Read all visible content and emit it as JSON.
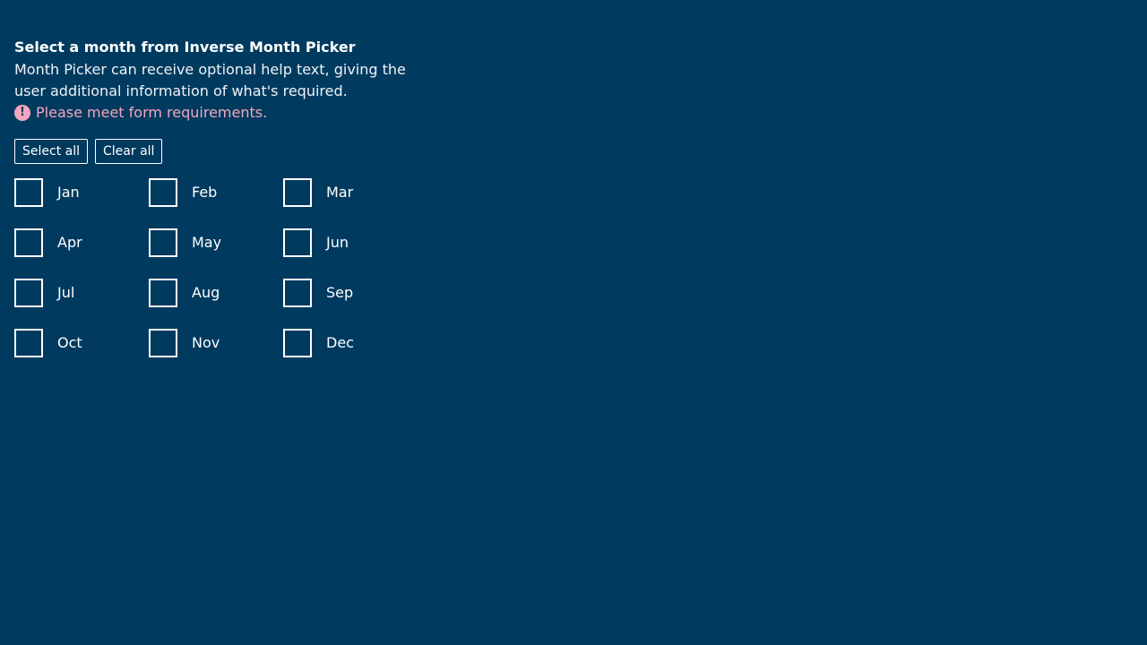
{
  "picker": {
    "legend": "Select a month from Inverse Month Picker",
    "help_text": "Month Picker can receive optional help text, giving the user additional information of what's required.",
    "error_text": "Please meet form requirements.",
    "error_icon": "!",
    "select_all_label": "Select all",
    "clear_all_label": "Clear all",
    "months": [
      {
        "label": "Jan",
        "checked": false
      },
      {
        "label": "Feb",
        "checked": false
      },
      {
        "label": "Mar",
        "checked": false
      },
      {
        "label": "Apr",
        "checked": false
      },
      {
        "label": "May",
        "checked": false
      },
      {
        "label": "Jun",
        "checked": false
      },
      {
        "label": "Jul",
        "checked": false
      },
      {
        "label": "Aug",
        "checked": false
      },
      {
        "label": "Sep",
        "checked": false
      },
      {
        "label": "Oct",
        "checked": false
      },
      {
        "label": "Nov",
        "checked": false
      },
      {
        "label": "Dec",
        "checked": false
      }
    ]
  },
  "colors": {
    "background": "#003a5f",
    "error": "#f4a6bd",
    "foreground": "#ffffff"
  }
}
